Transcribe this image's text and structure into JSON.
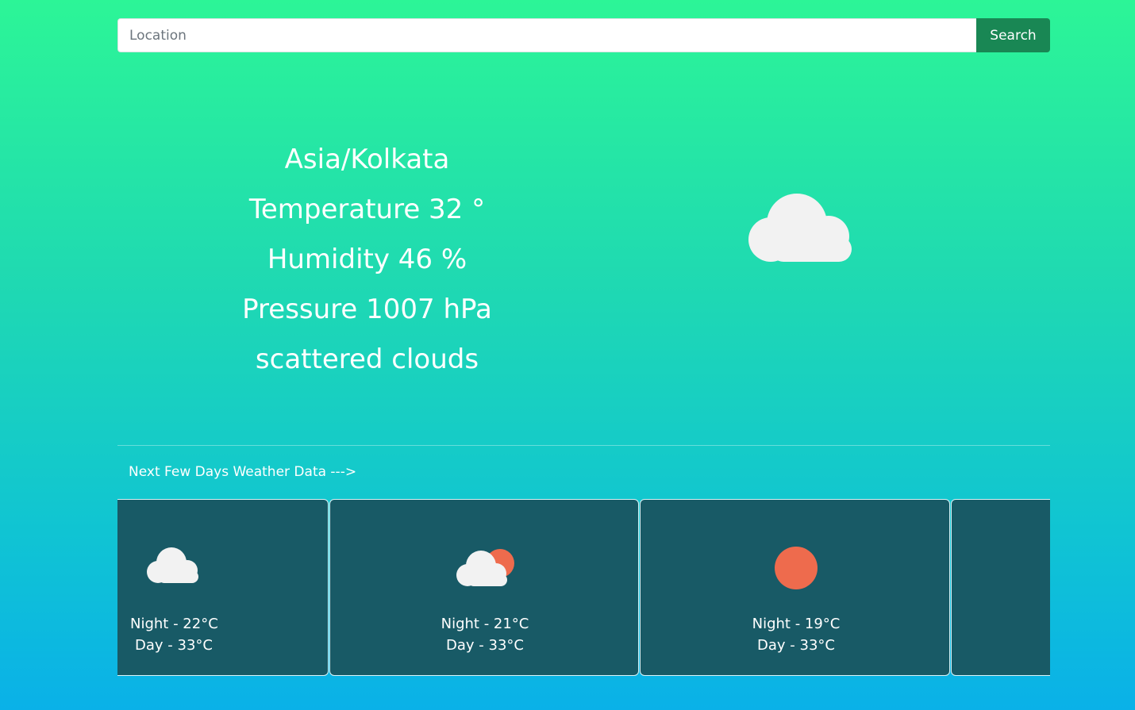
{
  "search": {
    "placeholder": "Location",
    "button_label": "Search"
  },
  "current": {
    "location": "Asia/Kolkata",
    "temperature_text": "Temperature 32 °",
    "humidity_text": "Humidity 46 %",
    "pressure_text": "Pressure 1007 hPa",
    "description": "scattered clouds",
    "icon": "cloud-icon"
  },
  "forecast": {
    "heading": "Next Few Days Weather Data --->",
    "cards": [
      {
        "icon": "cloud-icon",
        "night": "Night - 22°C",
        "day": "Day - 33°C"
      },
      {
        "icon": "sun-behind-cloud-icon",
        "night": "Night - 21°C",
        "day": "Day - 33°C"
      },
      {
        "icon": "sun-icon",
        "night": "Night - 19°C",
        "day": "Day - 33°C"
      }
    ]
  },
  "colors": {
    "gradient_top": "#2cf597",
    "gradient_bottom": "#0ab1e8",
    "button": "#198754",
    "card": "#185a66",
    "sun": "#ee6b4d",
    "cloud": "#f2f2f2"
  }
}
